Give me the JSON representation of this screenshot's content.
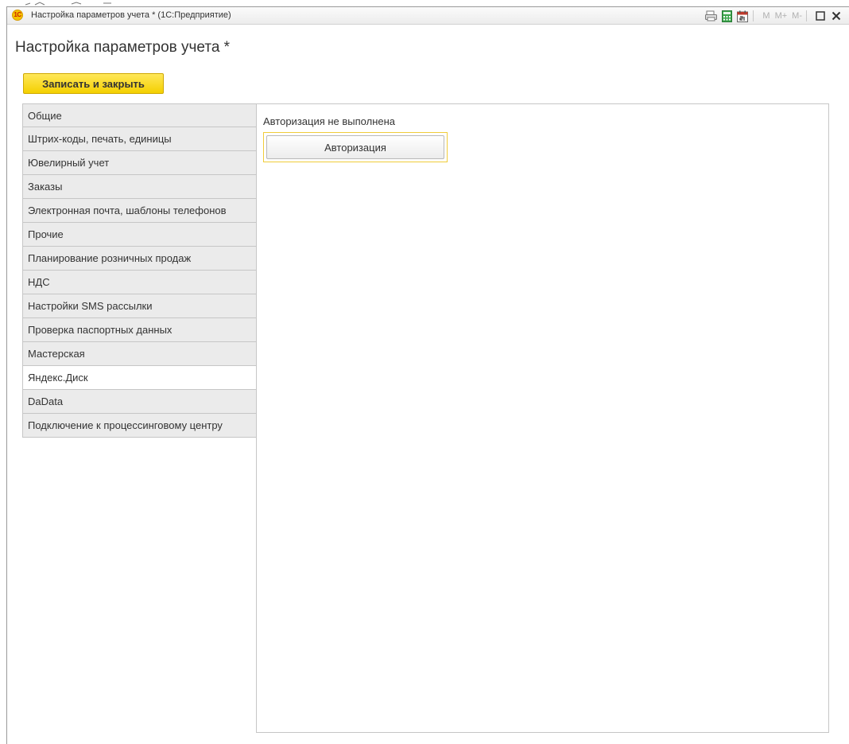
{
  "window": {
    "title": "Настройка параметров учета * (1С:Предприятие)",
    "logo_text": "1С",
    "toolbar": {
      "memory_buttons": [
        "M",
        "M+",
        "M-"
      ]
    }
  },
  "page": {
    "title": "Настройка параметров учета *",
    "save_close_label": "Записать и закрыть"
  },
  "tabs": [
    {
      "label": "Общие",
      "active": false
    },
    {
      "label": "Штрих-коды, печать, единицы",
      "active": false
    },
    {
      "label": "Ювелирный учет",
      "active": false
    },
    {
      "label": "Заказы",
      "active": false
    },
    {
      "label": "Электронная почта, шаблоны телефонов",
      "active": false
    },
    {
      "label": "Прочие",
      "active": false
    },
    {
      "label": "Планирование розничных продаж",
      "active": false
    },
    {
      "label": "НДС",
      "active": false
    },
    {
      "label": "Настройки SMS рассылки",
      "active": false
    },
    {
      "label": "Проверка паспортных данных",
      "active": false
    },
    {
      "label": "Мастерская",
      "active": false
    },
    {
      "label": "Яндекс.Диск",
      "active": true
    },
    {
      "label": "DaData",
      "active": false
    },
    {
      "label": "Подключение к процессинговому центру",
      "active": false
    }
  ],
  "content": {
    "status_text": "Авторизация не выполнена",
    "auth_button_label": "Авторизация"
  },
  "colors": {
    "accent_yellow": "#f4d000",
    "focus_frame": "#f0cc3a",
    "tab_background": "#ebebeb"
  }
}
